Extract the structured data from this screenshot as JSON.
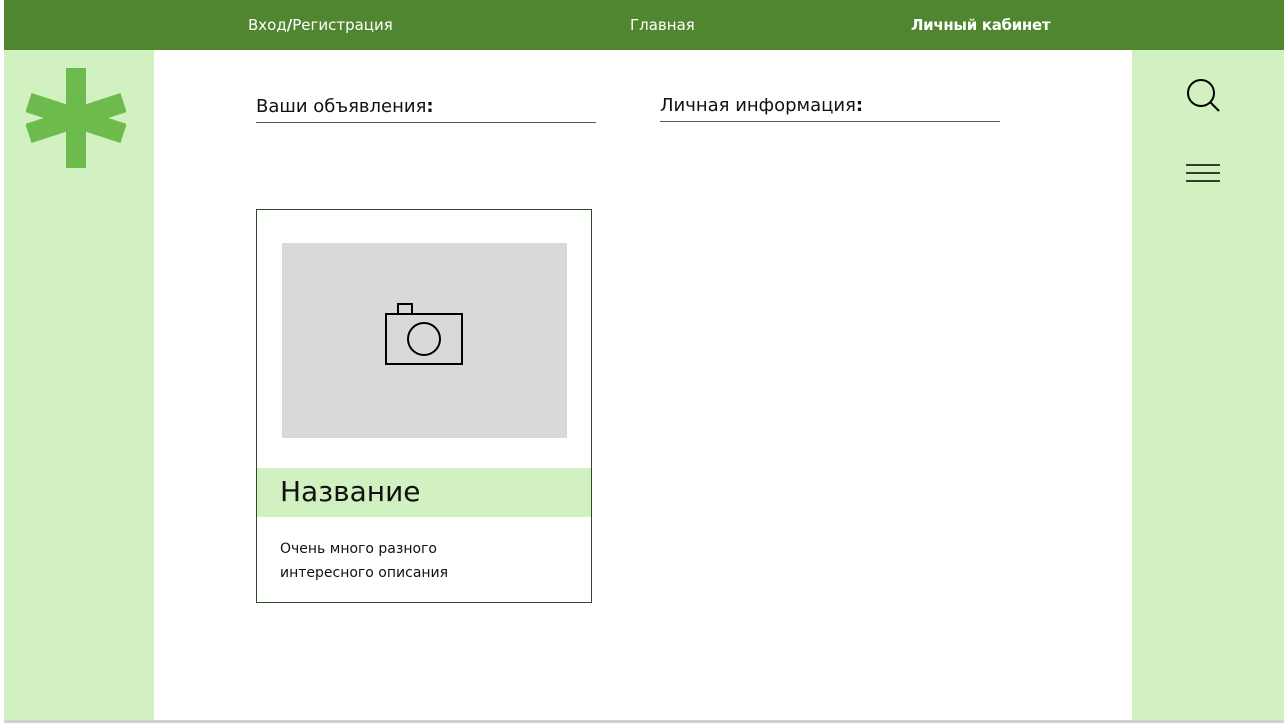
{
  "header": {
    "login": "Вход",
    "login_sep": "/",
    "register": "Регистрация",
    "home": "Главная",
    "account": "Личный кабинет"
  },
  "sections": {
    "ads_label": "Ваши объявления",
    "info_label": "Личная информация",
    "colon": ":"
  },
  "card": {
    "title": "Название",
    "description_line1": "Очень много разного",
    "description_line2": "интересного описания"
  },
  "icons": {
    "logo": "asterisk-logo",
    "search": "search-icon",
    "menu": "hamburger-menu-icon",
    "photo": "camera-icon"
  },
  "colors": {
    "header_bg": "#508630",
    "side_bg": "#d1f1c1",
    "logo": "#6cbb4c",
    "image_placeholder": "#d9d9d9"
  }
}
